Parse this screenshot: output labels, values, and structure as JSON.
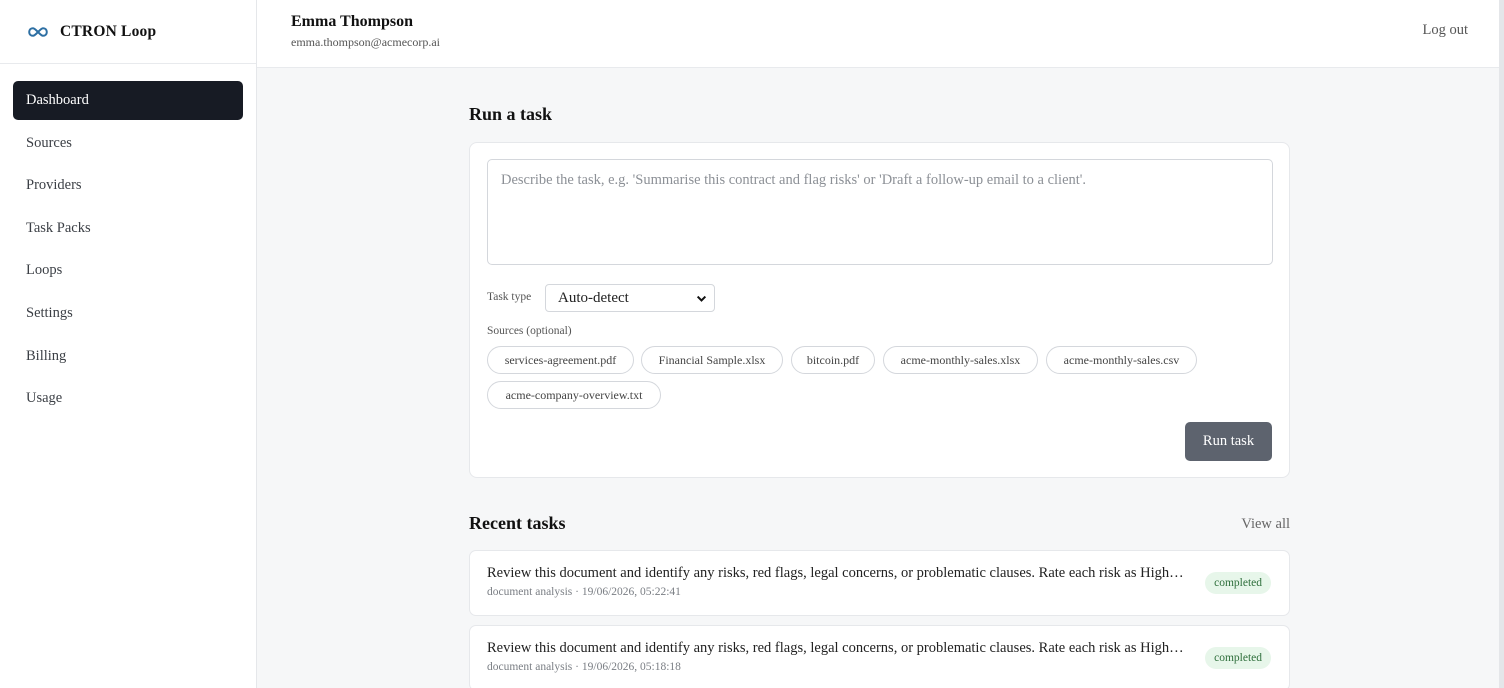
{
  "app": {
    "brand": "CTRON Loop",
    "logo_icon": "infinity-icon",
    "accent_color": "#2d6fa3"
  },
  "sidebar": {
    "items": [
      {
        "label": "Dashboard",
        "active": true
      },
      {
        "label": "Sources"
      },
      {
        "label": "Providers"
      },
      {
        "label": "Task Packs"
      },
      {
        "label": "Loops"
      },
      {
        "label": "Settings"
      },
      {
        "label": "Billing"
      },
      {
        "label": "Usage"
      }
    ]
  },
  "header": {
    "user_name": "Emma Thompson",
    "user_email": "emma.thompson@acmecorp.ai",
    "logout_label": "Log out"
  },
  "run_task": {
    "title": "Run a task",
    "input_value": "",
    "input_placeholder": "Describe the task, e.g. 'Summarise this contract and flag risks' or 'Draft a follow-up email to a client'.",
    "task_type_label": "Task type",
    "task_type_value": "Auto-detect",
    "sources_label": "Sources (optional)",
    "sources": [
      "services-agreement.pdf",
      "Financial Sample.xlsx",
      "bitcoin.pdf",
      "acme-monthly-sales.xlsx",
      "acme-monthly-sales.csv",
      "acme-company-overview.txt"
    ],
    "run_label": "Run task"
  },
  "recent": {
    "title": "Recent tasks",
    "view_all_label": "View all",
    "tasks": [
      {
        "text": "Review this document and identify any risks, red flags, legal concerns, or problematic clauses. Rate each risk as High, Medium or Low.",
        "type": "document analysis",
        "timestamp": "19/06/2026, 05:22:41",
        "status": "completed"
      },
      {
        "text": "Review this document and identify any risks, red flags, legal concerns, or problematic clauses. Rate each risk as High, Medium or Low.",
        "type": "document analysis",
        "timestamp": "19/06/2026, 05:18:18",
        "status": "completed"
      }
    ]
  },
  "colors": {
    "active_nav_bg": "#171b24",
    "run_button_bg": "#5d636e",
    "status_completed_bg": "#e7f6ea"
  }
}
